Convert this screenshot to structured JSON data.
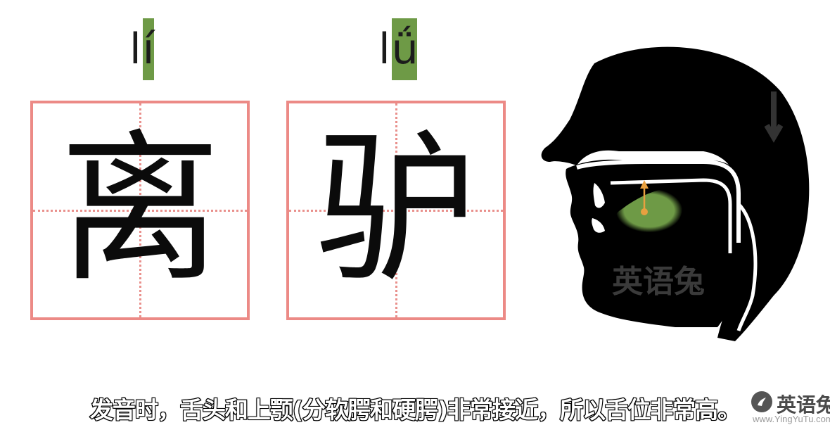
{
  "syllables": [
    {
      "initial": "l",
      "vowel": "í",
      "character": "离"
    },
    {
      "initial": "l",
      "vowel": "ǘ",
      "character": "驴"
    }
  ],
  "diagram": {
    "watermark": "英语兔",
    "highlight_color": "#6e9a46",
    "arrow_color": "#e8a040"
  },
  "subtitle": "发音时，舌头和上颚(分软腭和硬腭)非常接近，所以舌位非常高。",
  "brand": {
    "name": "英语兔",
    "url": "www.YingYuTu.com"
  },
  "colors": {
    "grid_border": "#ec8a86",
    "vowel_highlight": "#6e9a46"
  }
}
